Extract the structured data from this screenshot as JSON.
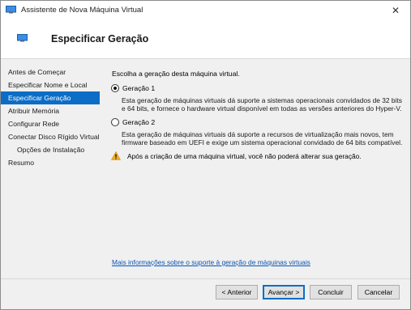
{
  "window": {
    "title": "Assistente de Nova Máquina Virtual",
    "close_glyph": "✕",
    "icon": "monitor-icon"
  },
  "header": {
    "title": "Especificar Geração",
    "icon": "monitor-icon"
  },
  "nav": {
    "items": [
      {
        "label": "Antes de Começar"
      },
      {
        "label": "Especificar Nome e Local"
      },
      {
        "label": "Especificar Geração"
      },
      {
        "label": "Atribuir Memória"
      },
      {
        "label": "Configurar Rede"
      },
      {
        "label": "Conectar Disco Rígido Virtual"
      },
      {
        "label": "Opções de Instalação"
      },
      {
        "label": "Resumo"
      }
    ],
    "active_index": 2
  },
  "main": {
    "intro": "Escolha a geração desta máquina virtual.",
    "options": [
      {
        "label": "Geração 1",
        "checked": true,
        "description": "Esta geração de máquinas virtuais dá suporte a sistemas operacionais convidados de 32 bits e 64 bits, e fornece o hardware virtual disponível em todas as versões anteriores do Hyper-V."
      },
      {
        "label": "Geração 2",
        "checked": false,
        "description": "Esta geração de máquinas virtuais dá suporte a recursos de virtualização mais novos, tem firmware baseado em UEFI e exige um sistema operacional convidado de 64 bits compatível."
      }
    ],
    "warning": "Após a criação de uma máquina virtual, você não poderá alterar sua geração.",
    "more_info_link": "Mais informações sobre o suporte à geração de máquinas virtuais"
  },
  "footer": {
    "previous_label": "< Anterior",
    "next_label": "Avançar >",
    "finish_label": "Concluir",
    "cancel_label": "Cancelar"
  },
  "colors": {
    "accent": "#0b6dc6",
    "link": "#0b55b3",
    "warning": "#f2b01e"
  }
}
